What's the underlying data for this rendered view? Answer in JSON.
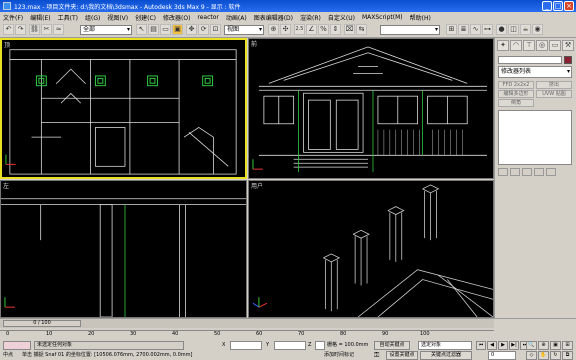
{
  "window": {
    "title": "123.max - 项目文件夹: d:\\我的文档\\3dsmax - Autodesk 3ds Max 9 - 显示 : 软件",
    "controls": [
      "_",
      "□",
      "×"
    ]
  },
  "menu": [
    "文件(F)",
    "编辑(E)",
    "工具(T)",
    "组(G)",
    "视图(V)",
    "创建(C)",
    "修改器(O)",
    "reactor",
    "动画(A)",
    "图表编辑器(D)",
    "渲染(R)",
    "自定义(U)",
    "MAXScript(M)",
    "帮助(H)"
  ],
  "toolbar": {
    "selection_filter": "全部",
    "ref_coord": "视图",
    "snap_label": "2.5",
    "named_selection": ""
  },
  "viewports": {
    "top_left_label": "顶",
    "top_right_label": "前",
    "bottom_left_label": "左",
    "bottom_right_label": "用户"
  },
  "command_panel": {
    "name_field": "",
    "modifier_list": "修改器列表",
    "buttons": [
      "FFD 2x2x2",
      "挤出",
      "编辑多边形",
      "UVW 贴图",
      "倒角"
    ]
  },
  "time": {
    "frame": "0 / 100",
    "ruler_ticks": [
      "0",
      "10",
      "20",
      "30",
      "40",
      "50",
      "60",
      "70",
      "80",
      "90",
      "100"
    ]
  },
  "status": {
    "selection": "未选定任何对象",
    "prompt": "单击 捕捉 Snaf 01 的坐标位置: [10506.076mm, 2700.002mm, 0.0mm]",
    "x_label": "X",
    "y_label": "Y",
    "z_label": "Z",
    "grid": "栅格 = 100.0mm",
    "auto_key": "自动关键点",
    "set_key": "设置关键点",
    "selected_dropdown": "选定对象",
    "key_filters": "关键点过滤器",
    "add_time_tag": "添加时间标记",
    "frame_field": "0",
    "left_label": "中点"
  }
}
